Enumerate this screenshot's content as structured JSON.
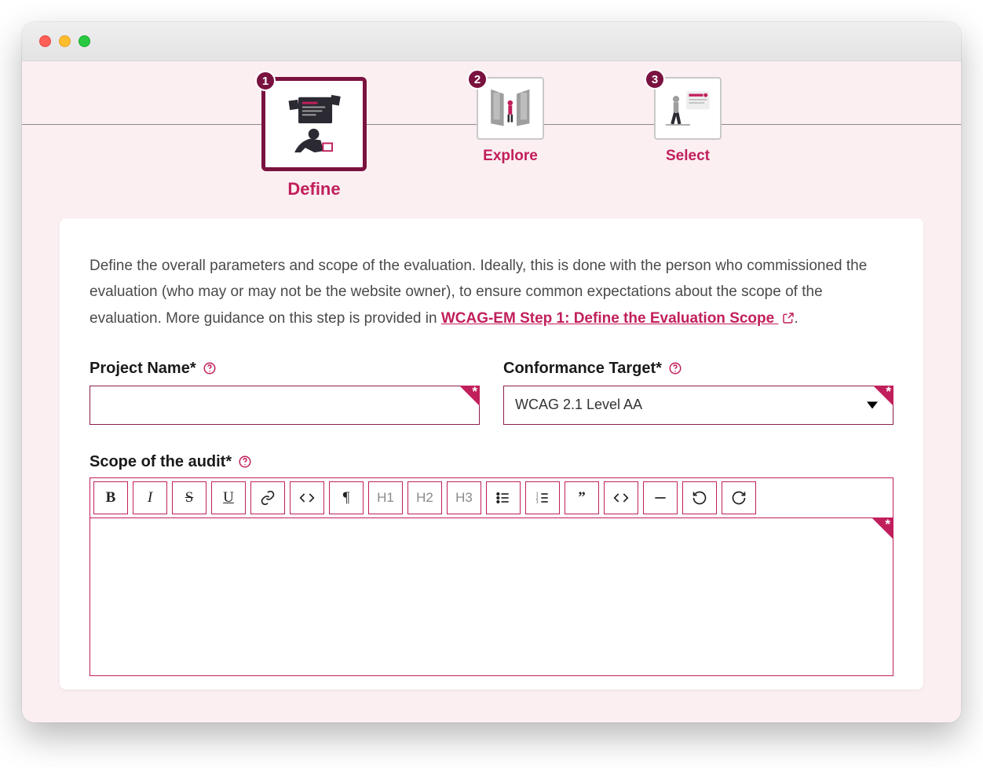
{
  "stepper": {
    "steps": [
      {
        "num": "1",
        "label": "Define",
        "active": true
      },
      {
        "num": "2",
        "label": "Explore",
        "active": false
      },
      {
        "num": "3",
        "label": "Select",
        "active": false
      }
    ]
  },
  "intro": {
    "pre": "Define the overall parameters and scope of the evaluation. Ideally, this is done with the person who commissioned the evaluation (who may or may not be the website owner), to ensure common expectations about the scope of the evaluation. More guidance on this step is provided in ",
    "link": "WCAG-EM Step 1: Define the Evaluation Scope",
    "post": "."
  },
  "fields": {
    "project_name": {
      "label": "Project Name*",
      "value": ""
    },
    "conformance": {
      "label": "Conformance Target*",
      "value": "WCAG 2.1 Level AA"
    },
    "scope": {
      "label": "Scope of the audit*",
      "value": ""
    }
  },
  "toolbar": {
    "h1": "H1",
    "h2": "H2",
    "h3": "H3"
  }
}
